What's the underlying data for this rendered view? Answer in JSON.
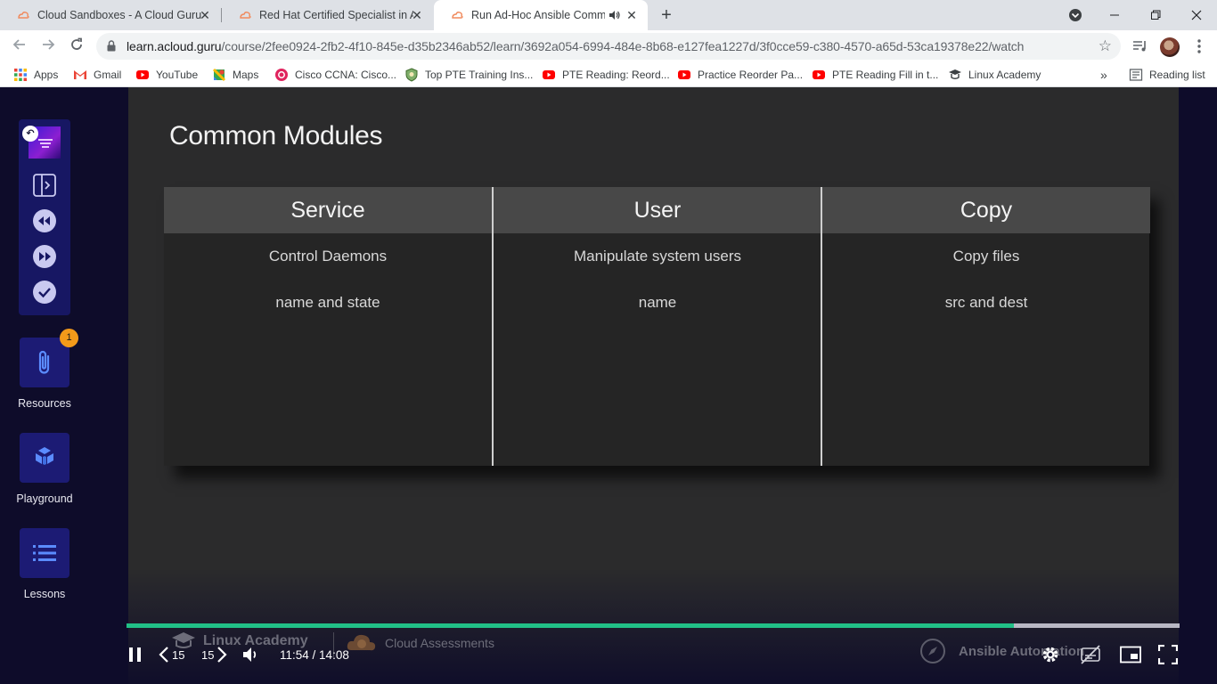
{
  "browser": {
    "tabs": [
      {
        "title": "Cloud Sandboxes - A Cloud Guru",
        "active": false
      },
      {
        "title": "Red Hat Certified Specialist in An",
        "active": false
      },
      {
        "title": "Run Ad-Hoc Ansible Comma",
        "active": true
      }
    ],
    "url_host": "learn.acloud.guru",
    "url_path": "/course/2fee0924-2fb2-4f10-845e-d35b2346ab52/learn/3692a054-6994-484e-8b68-e127fea1227d/3f0cce59-c380-4570-a65d-53ca19378e22/watch",
    "bookmarks": [
      {
        "label": "Apps",
        "icon": "apps-grid-icon"
      },
      {
        "label": "Gmail",
        "icon": "gmail-icon"
      },
      {
        "label": "YouTube",
        "icon": "youtube-icon"
      },
      {
        "label": "Maps",
        "icon": "maps-icon"
      },
      {
        "label": "Cisco CCNA: Cisco...",
        "icon": "cisco-icon"
      },
      {
        "label": "Top PTE Training Ins...",
        "icon": "shield-icon"
      },
      {
        "label": "PTE Reading: Reord...",
        "icon": "youtube-icon"
      },
      {
        "label": "Practice Reorder Pa...",
        "icon": "youtube-icon"
      },
      {
        "label": "PTE Reading Fill in t...",
        "icon": "youtube-icon"
      },
      {
        "label": "Linux Academy",
        "icon": "linux-academy-icon"
      }
    ],
    "more_bookmarks": "»",
    "reading_list": "Reading list"
  },
  "sidebar": {
    "resources_label": "Resources",
    "resources_badge": "1",
    "playground_label": "Playground",
    "lessons_label": "Lessons"
  },
  "slide": {
    "title": "Common Modules",
    "columns": [
      {
        "header": "Service",
        "desc": "Control Daemons",
        "params": "name and state"
      },
      {
        "header": "User",
        "desc": "Manipulate system users",
        "params": "name"
      },
      {
        "header": "Copy",
        "desc": "Copy files",
        "params": "src and dest"
      }
    ],
    "watermark_left": "Linux Academy",
    "watermark_mid": "Cloud Assessments",
    "watermark_right": "Ansible Automation"
  },
  "player": {
    "rewind_seconds": "15",
    "forward_seconds": "15",
    "current_time": "11:54",
    "total_time": "14:08",
    "progress_fraction": 0.843,
    "accent_color": "#21c087"
  }
}
